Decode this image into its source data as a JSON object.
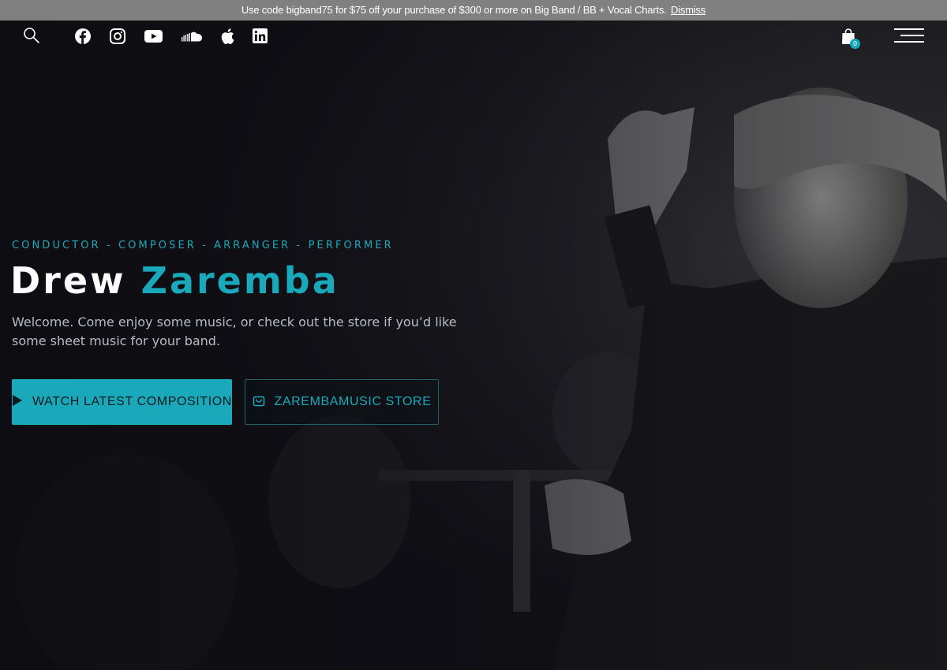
{
  "promo": {
    "text": "Use code bigband75 for $75 off your purchase of $300 or more on Big Band / BB + Vocal Charts.",
    "dismiss_label": "Dismiss"
  },
  "nav": {
    "icons": [
      "search-icon",
      "facebook-icon",
      "instagram-icon",
      "youtube-icon",
      "soundcloud-icon",
      "apple-icon",
      "linkedin-icon",
      "cart-icon",
      "menu-icon"
    ],
    "cart_count": "0"
  },
  "hero": {
    "eyebrow": "CONDUCTOR - COMPOSER - ARRANGER - PERFORMER",
    "name_first": "Drew",
    "name_last": "Zaremba",
    "lede": "Welcome. Come enjoy some music, or check out the store if you’d like some sheet music for your band.",
    "primary_button": "WATCH LATEST COMPOSITION",
    "secondary_button": "ZAREMBAMUSIC STORE"
  },
  "colors": {
    "accent": "#1aa9bb",
    "promo_bg": "#808080",
    "background": "#111116"
  }
}
